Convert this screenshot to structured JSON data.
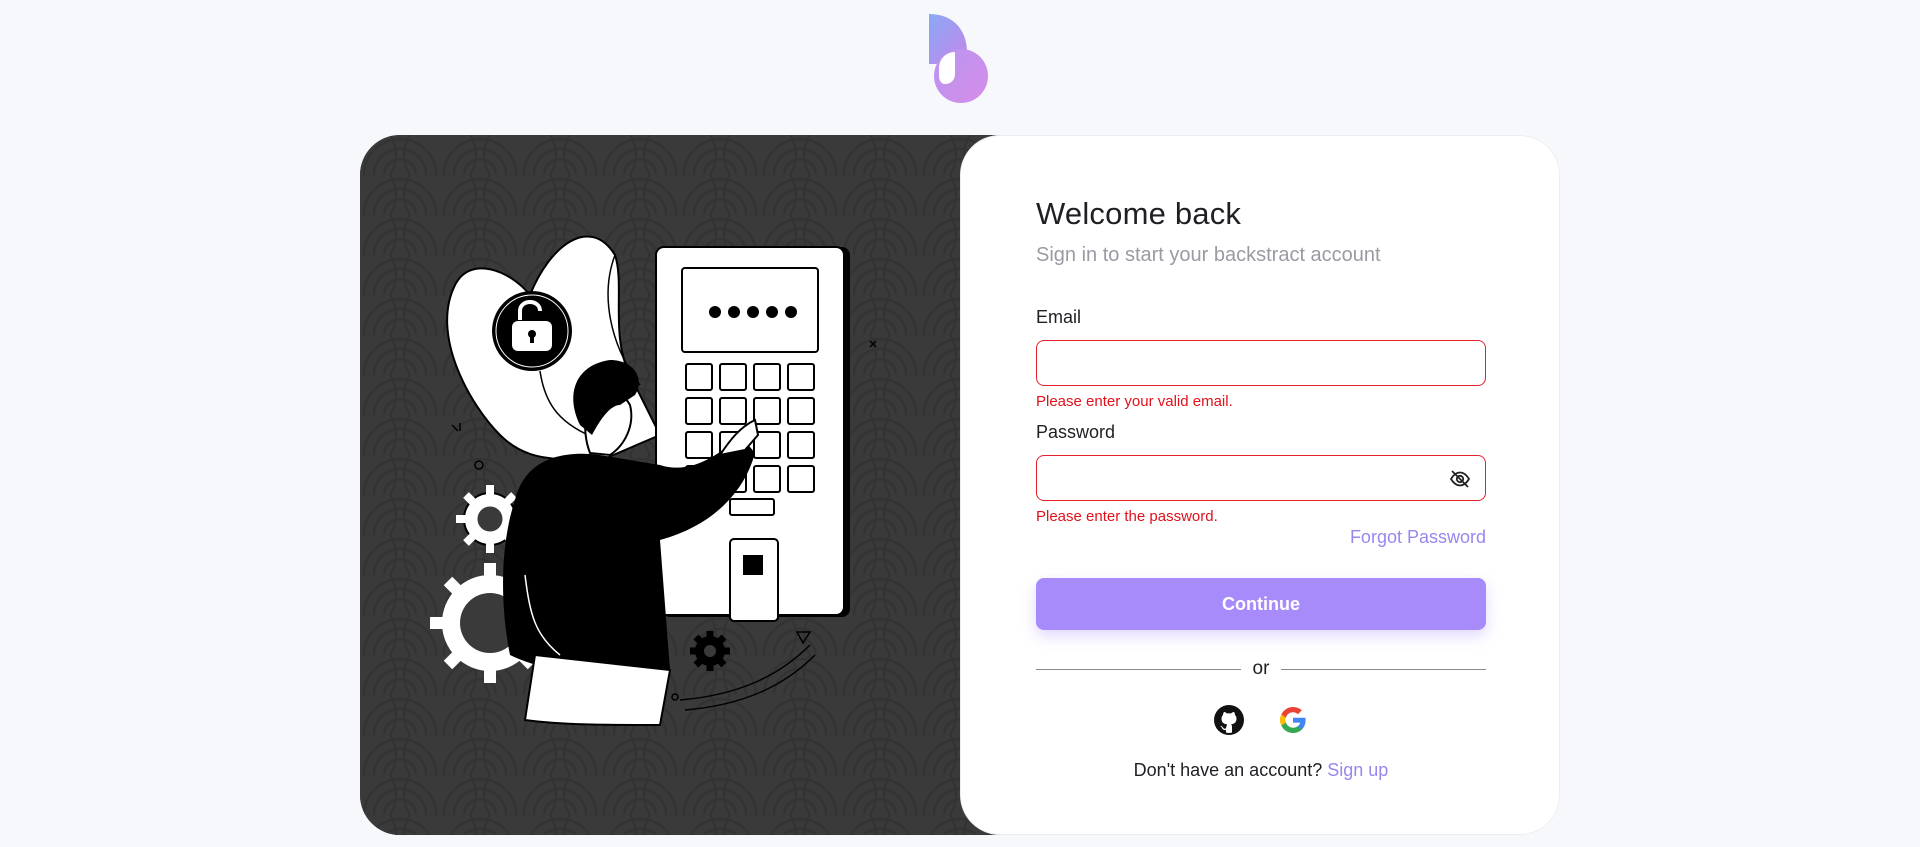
{
  "brand": {
    "logo_name": "backstract-logo"
  },
  "form": {
    "title": "Welcome back",
    "subtitle": "Sign in to start your backstract account",
    "email": {
      "label": "Email",
      "value": "",
      "placeholder": "",
      "error": "Please enter your valid email."
    },
    "password": {
      "label": "Password",
      "value": "",
      "placeholder": "",
      "error": "Please enter the password."
    },
    "forgot_label": "Forgot Password",
    "continue_label": "Continue",
    "divider_label": "or",
    "signup_prompt": "Don't have an account?",
    "signup_label": "Sign up"
  },
  "socials": [
    "github-icon",
    "google-icon"
  ],
  "colors": {
    "accent": "#a78bfa",
    "error": "#e0111b",
    "panel_dark": "#3a3a3a",
    "background": "#f7f8fc"
  }
}
